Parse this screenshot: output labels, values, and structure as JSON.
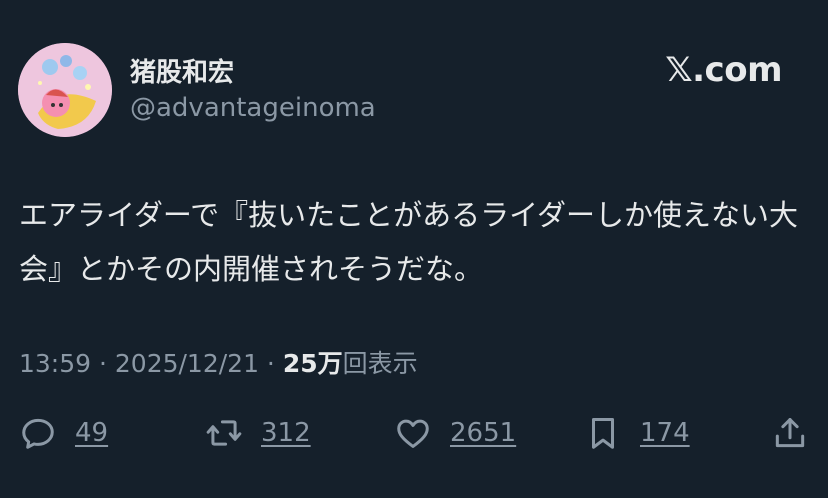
{
  "colors": {
    "background": "#15202b",
    "text": "#e7e9ea",
    "muted": "#8b98a5"
  },
  "author": {
    "display_name": "猪股和宏",
    "handle": "@advantageinoma"
  },
  "site_logo": "𝕏.com",
  "tweet": {
    "text": "エアライダーで『抜いたことがあるライダーしか使えない大会』とかその内開催されそうだな。"
  },
  "meta": {
    "time": "13:59",
    "sep1": " · ",
    "date": "2025/12/21",
    "sep2": " · ",
    "views_count": "25万",
    "views_label": "回表示"
  },
  "actions": {
    "reply": {
      "icon": "reply-icon",
      "count": "49"
    },
    "repost": {
      "icon": "repost-icon",
      "count": "312"
    },
    "like": {
      "icon": "heart-icon",
      "count": "2651"
    },
    "bookmark": {
      "icon": "bookmark-icon",
      "count": "174"
    },
    "share": {
      "icon": "share-icon"
    }
  }
}
